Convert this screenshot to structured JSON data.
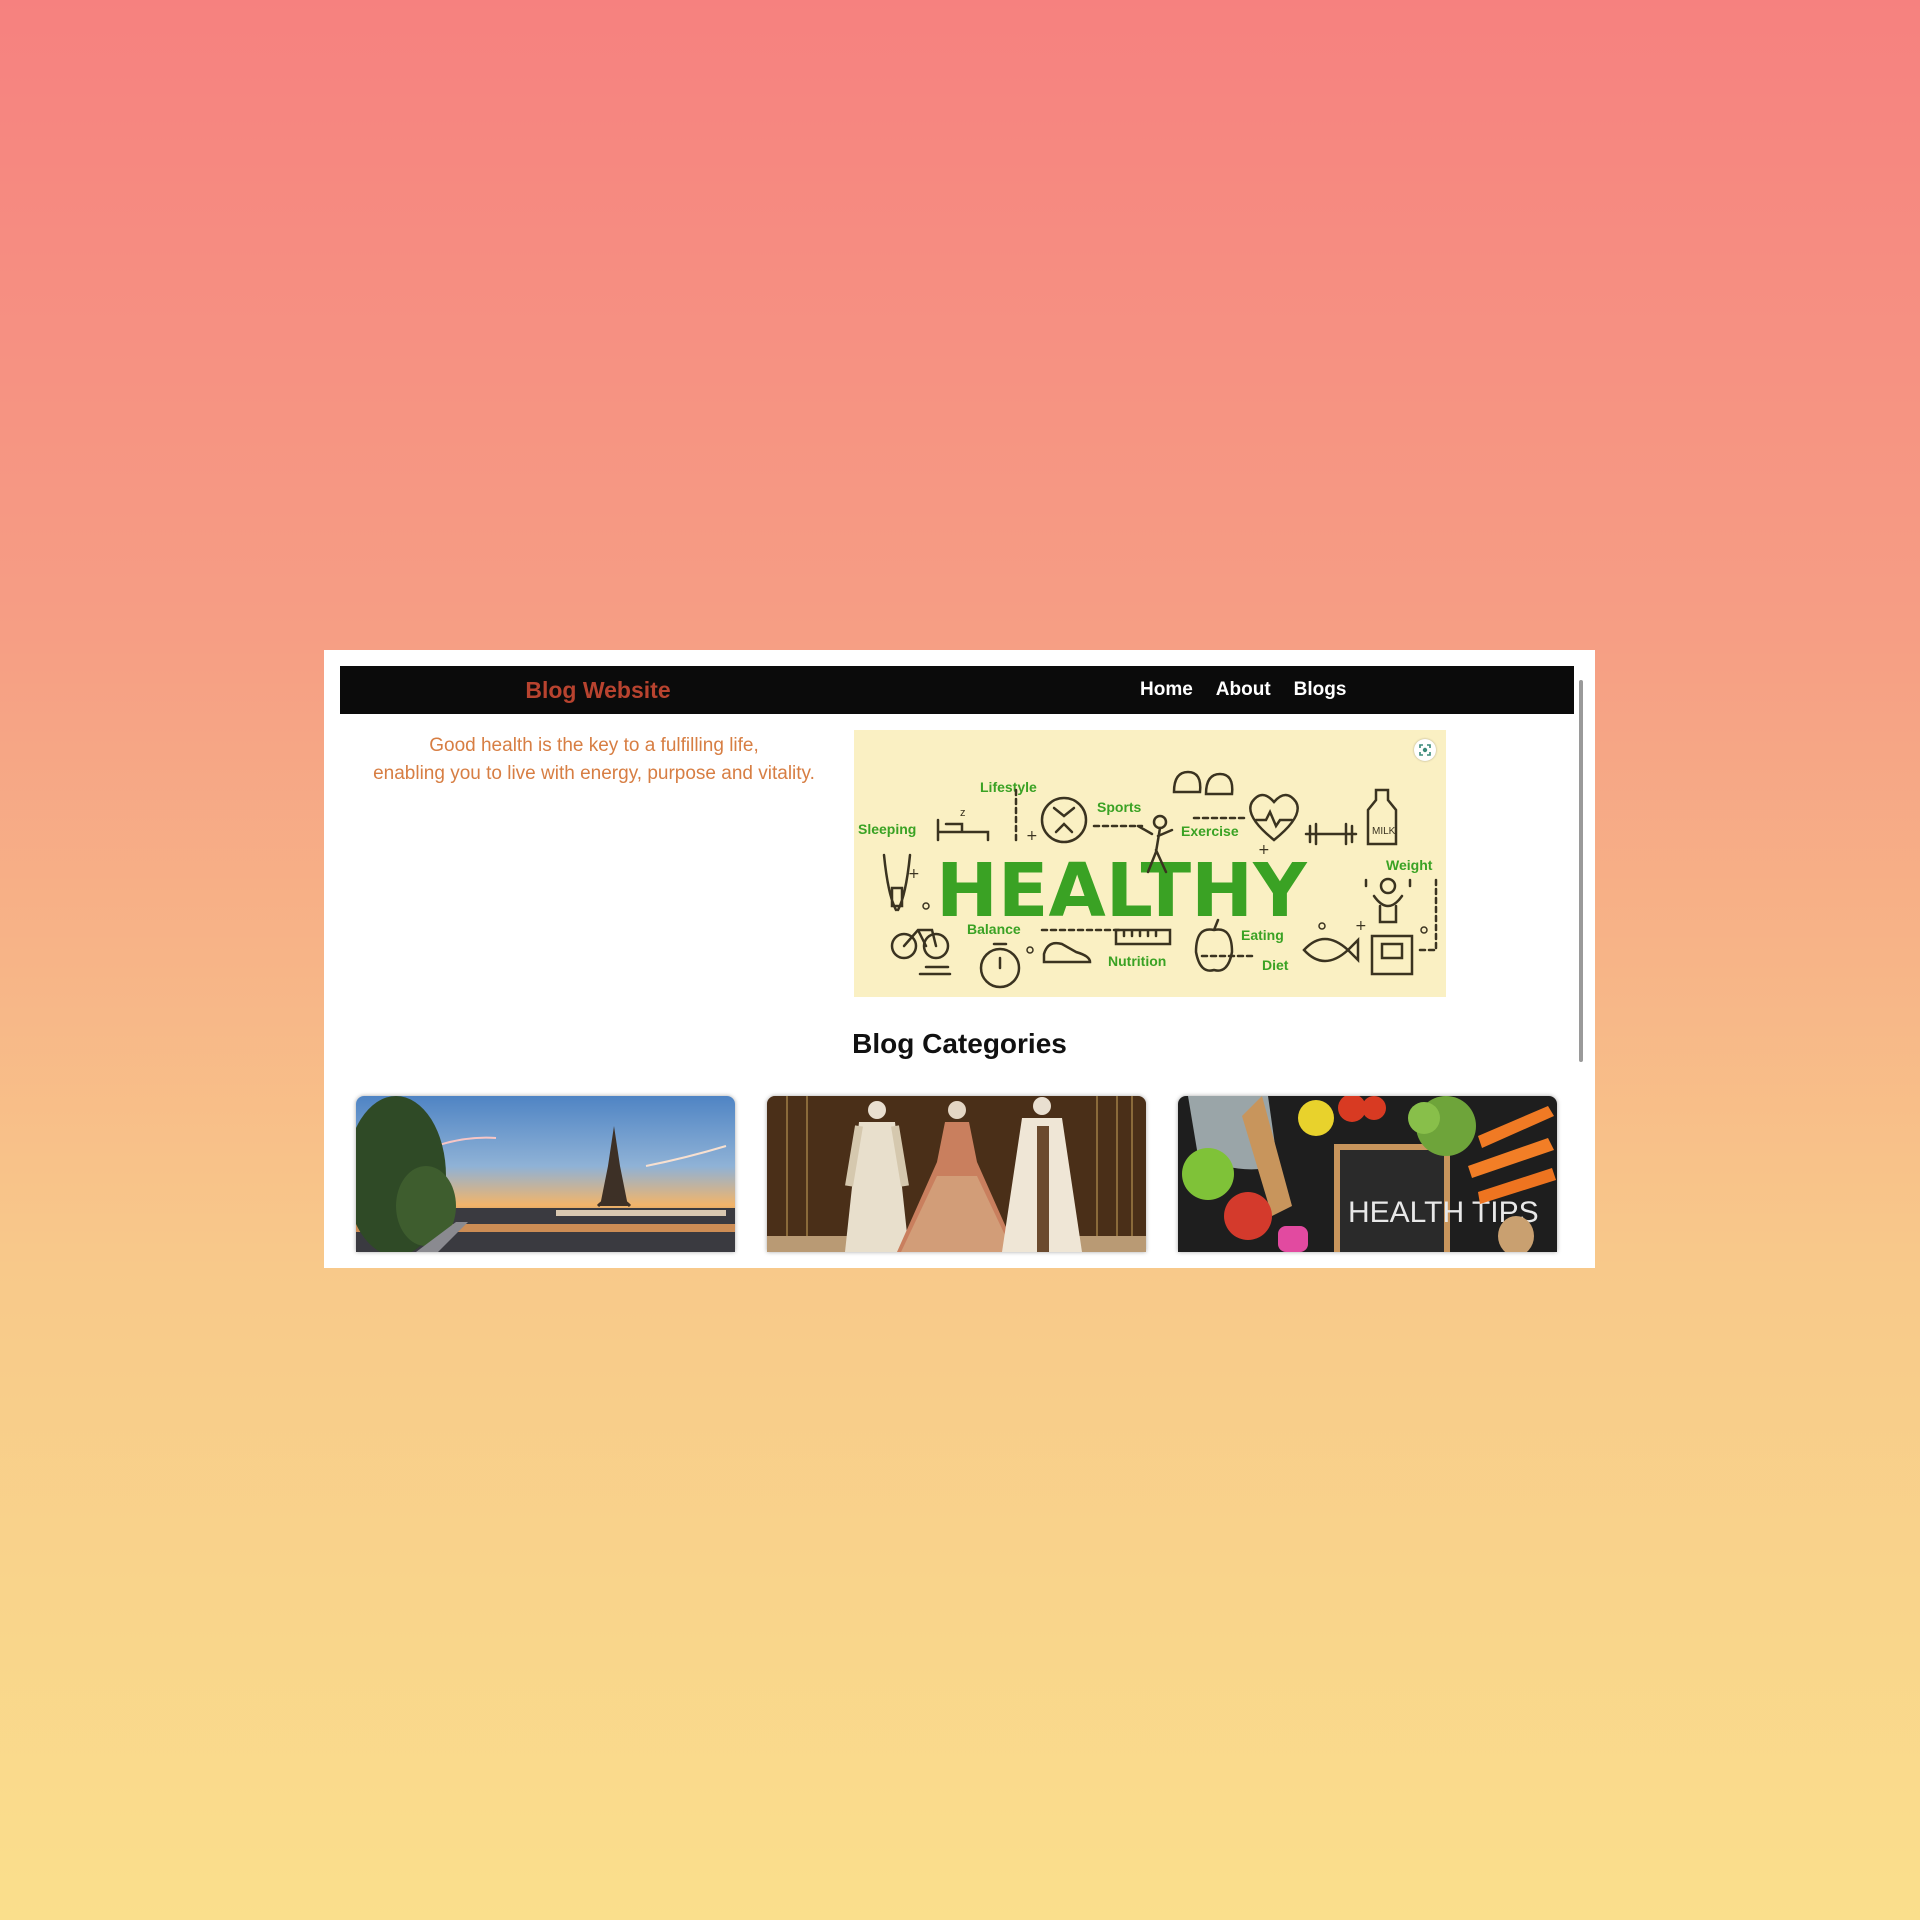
{
  "navbar": {
    "brand": "Blog Website",
    "links": [
      "Home",
      "About",
      "Blogs"
    ]
  },
  "hero": {
    "text_line1": "Good health is the key to a fulfilling life,",
    "text_line2": "enabling you to live with energy, purpose and vitality.",
    "image": {
      "headline": "HEALTHY",
      "words": [
        "Lifestyle",
        "Sports",
        "Sleeping",
        "Exercise",
        "Weight",
        "Balance",
        "Eating",
        "Nutrition",
        "Diet"
      ],
      "milk_label": "MILK"
    }
  },
  "categories": {
    "title": "Blog Categories",
    "cards": [
      {
        "subject": "Eiffel Tower at sunset"
      },
      {
        "subject": "Fashion mannequins"
      },
      {
        "subject": "Healthy food",
        "sign_text": "HEALTH TIPS"
      }
    ]
  },
  "colors": {
    "brand": "#b8432f",
    "hero_text": "#d77e43",
    "healthy_green": "#3aa224",
    "navbar_bg": "#0b0b0b"
  }
}
